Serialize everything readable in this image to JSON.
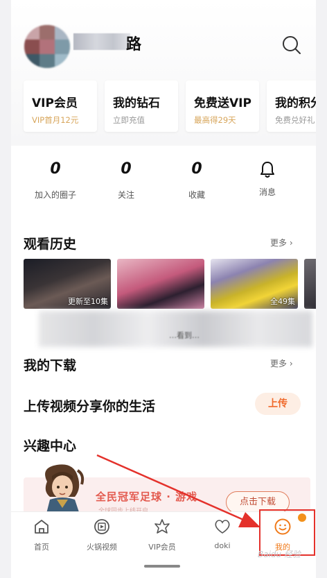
{
  "header": {
    "user_name_visible": "路",
    "search_icon": "search-icon"
  },
  "cards": [
    {
      "title": "VIP会员",
      "subtitle": "VIP首月12元",
      "accent": "#d7a55a"
    },
    {
      "title": "我的钻石",
      "subtitle": "立即充值"
    },
    {
      "title": "免费送VIP",
      "subtitle": "最高得29天",
      "accent": "#d7a55a"
    },
    {
      "title": "我的积分",
      "subtitle": "免费兑好礼"
    }
  ],
  "stats": [
    {
      "value": "0",
      "label": "加入的圈子"
    },
    {
      "value": "0",
      "label": "关注"
    },
    {
      "value": "0",
      "label": "收藏"
    },
    {
      "icon": "bell-icon",
      "label": "消息"
    }
  ],
  "history": {
    "title": "观看历史",
    "more": "更多 ›",
    "items": [
      {
        "badge": "更新至10集"
      },
      {
        "badge": ""
      },
      {
        "badge": "全49集"
      }
    ],
    "blurred_text": "…看到…"
  },
  "downloads": {
    "title": "我的下载",
    "more": "更多 ›"
  },
  "upload": {
    "title": "上传视频分享你的生活",
    "button": "上传"
  },
  "interest": {
    "title": "兴趣中心",
    "banner_text": "全民冠军足球 · 游戏",
    "banner_sub": "全球同步上线开启",
    "download_button": "点击下载"
  },
  "bottom_nav": [
    {
      "label": "首页",
      "icon": "home-icon"
    },
    {
      "label": "火锅视频",
      "icon": "film-icon"
    },
    {
      "label": "VIP会员",
      "icon": "crown-icon"
    },
    {
      "label": "doki",
      "icon": "heart-icon"
    },
    {
      "label": "我的",
      "icon": "smiley-icon",
      "active": true
    }
  ],
  "watermark": "Baidu 经验",
  "colors": {
    "accent_orange": "#f07a1a",
    "highlight_red": "#e4312b",
    "gold": "#d7a55a"
  }
}
